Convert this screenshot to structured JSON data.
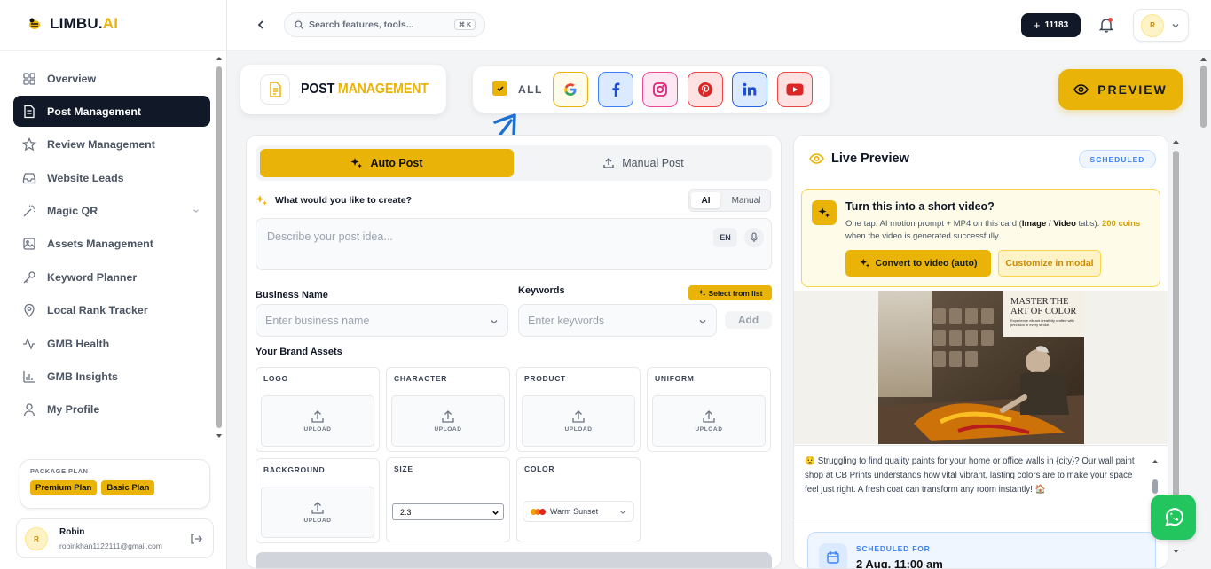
{
  "brand": {
    "name_main": "LIMBU.",
    "name_accent": "AI"
  },
  "sidebar": {
    "items": [
      {
        "label": "Overview",
        "icon": "grid-icon",
        "active": false
      },
      {
        "label": "Post Management",
        "icon": "document-icon",
        "active": true
      },
      {
        "label": "Review Management",
        "icon": "star-icon",
        "active": false
      },
      {
        "label": "Website Leads",
        "icon": "inbox-icon",
        "active": false
      },
      {
        "label": "Magic QR",
        "icon": "magic-wand-icon",
        "active": false
      },
      {
        "label": "Assets Management",
        "icon": "image-icon",
        "active": false
      },
      {
        "label": "Keyword Planner",
        "icon": "key-icon",
        "active": false
      },
      {
        "label": "Local Rank Tracker",
        "icon": "map-pin-icon",
        "active": false
      },
      {
        "label": "GMB Health",
        "icon": "activity-icon",
        "active": false
      },
      {
        "label": "GMB Insights",
        "icon": "bar-chart-icon",
        "active": false
      },
      {
        "label": "My Profile",
        "icon": "user-icon",
        "active": false
      }
    ],
    "plan": {
      "title": "PACKAGE PLAN",
      "badges": [
        "Premium Plan",
        "Basic Plan"
      ]
    },
    "user": {
      "initial": "R",
      "name": "Robin",
      "email": "robinkhan1122111@gmail.com"
    }
  },
  "topbar": {
    "search_placeholder": "Search features, tools...",
    "shortcut": "⌘ K",
    "coins": "11183",
    "profile_initial": "R"
  },
  "header": {
    "title_main": "POST",
    "title_accent": "MANAGEMENT",
    "all_label": "ALL",
    "platforms": [
      "google",
      "facebook",
      "instagram",
      "pinterest",
      "linkedin",
      "youtube"
    ],
    "preview_label": "PREVIEW"
  },
  "form": {
    "tab_auto": "Auto Post",
    "tab_manual": "Manual Post",
    "prompt_label": "What would you like to create?",
    "mode_ai": "AI",
    "mode_manual": "Manual",
    "prompt_placeholder": "Describe your post idea...",
    "lang": "EN",
    "business_label": "Business Name",
    "business_placeholder": "Enter business name",
    "keywords_label": "Keywords",
    "select_from_list": "Select from list",
    "keywords_placeholder": "Enter keywords",
    "add_label": "Add",
    "brand_assets_label": "Your Brand Assets",
    "assets": [
      "LOGO",
      "CHARACTER",
      "PRODUCT",
      "UNIFORM",
      "BACKGROUND"
    ],
    "upload_label": "UPLOAD",
    "size_label": "SIZE",
    "size_value": "2:3",
    "color_label": "COLOR",
    "color_value": "Warm Sunset"
  },
  "preview": {
    "title": "Live Preview",
    "status": "SCHEDULED",
    "video": {
      "title": "Turn this into a short video?",
      "desc_1": "One tap: AI motion prompt + MP4 on this card (",
      "image": "Image",
      "slash": " / ",
      "video": "Video",
      "desc_2": " tabs). ",
      "coins": "200 coins",
      "desc_3": " when the video is generated successfully.",
      "convert_label": "Convert to video (auto)",
      "customize_label": "Customize in modal"
    },
    "image_heading_1": "MASTER THE",
    "image_heading_2": "ART OF COLOR",
    "image_sub": "Experience vibrant creativity crafted with precision in every stroke.",
    "caption": "😟 Struggling to find quality paints for your home or office walls in {city}? Our wall paint shop at CB Prints understands how vital vibrant, lasting colors are to make your space feel just right. A fresh coat can transform any room instantly! 🏠",
    "scheduled_for_label": "SCHEDULED FOR",
    "scheduled_for_value": "2 Aug, 11:00 am"
  },
  "colors": {
    "accent": "#eab308",
    "dark": "#111827",
    "whatsapp": "#22c55e"
  }
}
